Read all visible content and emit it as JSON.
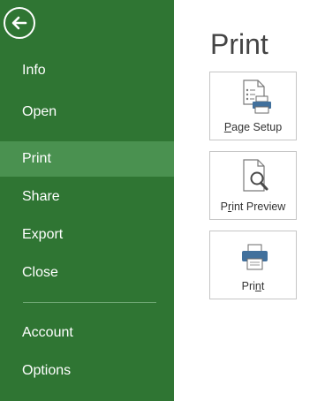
{
  "sidebar": {
    "back_icon": "back-arrow-icon",
    "items": [
      {
        "label": "Info"
      },
      {
        "label": "Open"
      },
      {
        "label": "Print",
        "active": true
      },
      {
        "label": "Share"
      },
      {
        "label": "Export"
      },
      {
        "label": "Close"
      },
      {
        "label": "Account"
      },
      {
        "label": "Options"
      }
    ],
    "colors": {
      "background": "#2f7533",
      "active": "#4a9150"
    }
  },
  "main": {
    "title": "Print",
    "tiles": [
      {
        "label_pre": "",
        "label_key": "P",
        "label_post": "age Setup",
        "icon": "page-setup-icon"
      },
      {
        "label_pre": "P",
        "label_key": "r",
        "label_post": "int Preview",
        "icon": "print-preview-icon"
      },
      {
        "label_pre": "Pri",
        "label_key": "n",
        "label_post": "t",
        "icon": "printer-icon"
      }
    ]
  }
}
